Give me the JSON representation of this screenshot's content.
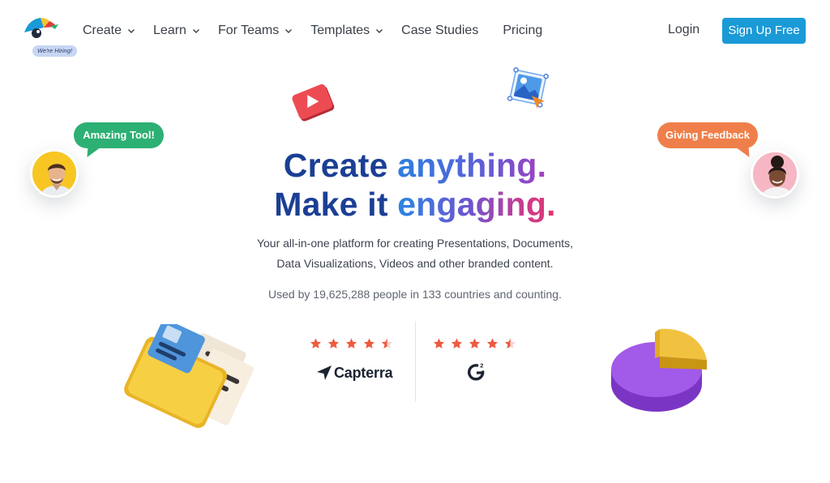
{
  "logo": {
    "badge": "We're Hiring!"
  },
  "nav": {
    "items": [
      {
        "label": "Create",
        "has_dropdown": true
      },
      {
        "label": "Learn",
        "has_dropdown": true
      },
      {
        "label": "For Teams",
        "has_dropdown": true
      },
      {
        "label": "Templates",
        "has_dropdown": true
      },
      {
        "label": "Case Studies",
        "has_dropdown": false
      },
      {
        "label": "Pricing",
        "has_dropdown": false
      }
    ],
    "login": "Login",
    "signup": "Sign Up Free"
  },
  "hero": {
    "line1_a": "Create",
    "line1_b": "anything.",
    "line2_a": "Make it",
    "line2_b": "engaging.",
    "subtitle_line1": "Your all-in-one platform for creating Presentations, Documents,",
    "subtitle_line2": "Data Visualizations, Videos and other branded content.",
    "usage": "Used by 19,625,288 people in 133 countries and counting."
  },
  "testimonials": {
    "left_bubble": "Amazing Tool!",
    "right_bubble": "Giving Feedback"
  },
  "ratings": [
    {
      "source": "Capterra",
      "stars": 4.5
    },
    {
      "source": "G2",
      "stars": 4.5
    }
  ],
  "colors": {
    "primary_button": "#1a9ad6",
    "title_dark_blue": "#1b3f94",
    "bubble_green": "#2db073",
    "bubble_orange": "#ef7f4a",
    "star": "#ee5a3f"
  },
  "icons": {
    "nav_dropdown": "chevron-down-icon",
    "rating": "star-icon",
    "capterra": "capterra-arrow-icon",
    "g2": "g2-logo-icon"
  }
}
